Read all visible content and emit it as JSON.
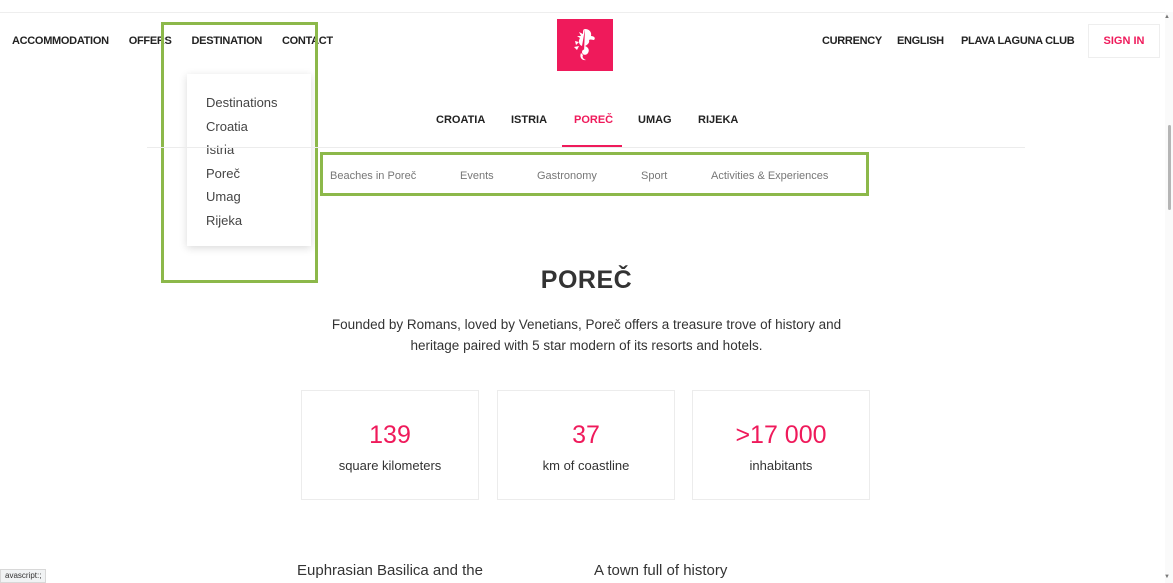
{
  "header": {
    "nav_left": [
      "ACCOMMODATION",
      "OFFERS",
      "DESTINATION",
      "CONTACT"
    ],
    "nav_right": {
      "currency": "CURRENCY",
      "language": "ENGLISH",
      "club": "PLAVA LAGUNA CLUB"
    },
    "sign_in": "SIGN IN",
    "logo_icon": "seahorse-icon",
    "brand_color": "#ef1a5b"
  },
  "dropdown": {
    "items": [
      "Destinations",
      "Croatia",
      "Istria",
      "Poreč",
      "Umag",
      "Rijeka"
    ]
  },
  "sub_nav": {
    "items": [
      "CROATIA",
      "ISTRIA",
      "POREČ",
      "UMAG",
      "RIJEKA"
    ],
    "active": "POREČ"
  },
  "tertiary_nav": {
    "items": [
      "Beaches in Poreč",
      "Events",
      "Gastronomy",
      "Sport",
      "Activities & Experiences"
    ]
  },
  "main": {
    "title": "POREČ",
    "intro_line1": "Founded by Romans, loved by Venetians, Poreč offers a treasure trove of history and",
    "intro_line2": "heritage paired with 5 star modern of its resorts and hotels.",
    "stats": [
      {
        "value": "139",
        "label": "square kilometers"
      },
      {
        "value": "37",
        "label": "km of coastline"
      },
      {
        "value": ">17 000",
        "label": "inhabitants"
      }
    ],
    "section_headings": [
      "Euphrasian Basilica and the",
      "A town full of history"
    ]
  },
  "status_bar": {
    "text": "avascript:;"
  },
  "highlight_color": "#8cb84a"
}
